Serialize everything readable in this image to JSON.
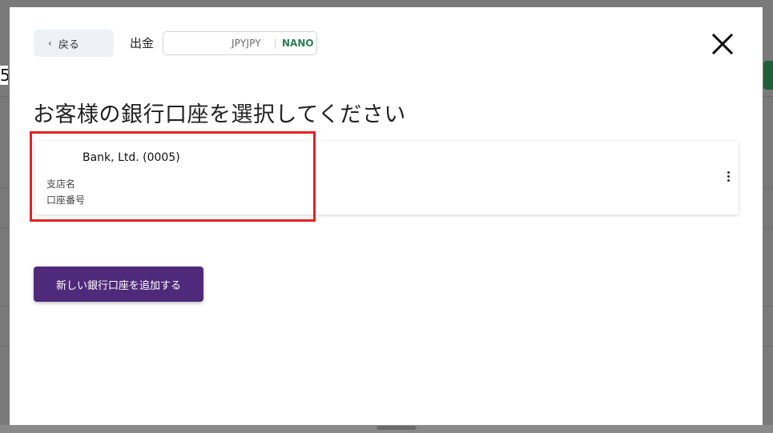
{
  "header": {
    "back_label": "戻る",
    "withdraw_label": "出金",
    "amount_value": "",
    "currency_code": "JPYJPY",
    "network_label": "NANO"
  },
  "main": {
    "title": "お客様の銀行口座を選択してください",
    "bank_account": {
      "bank_name": "Bank, Ltd. (0005)",
      "branch_label": "支店名",
      "account_number_label": "口座番号"
    },
    "add_button_label": "新しい銀行口座を追加する"
  },
  "background": {
    "partial_glyph": "5"
  },
  "icons": {
    "back": "chevron-left-icon",
    "close": "close-icon",
    "more": "more-vertical-icon"
  },
  "colors": {
    "accent_purple": "#4f2a7a",
    "network_green": "#2f7d55",
    "highlight_red": "#e02323",
    "overlay": "#7a7a7a"
  }
}
